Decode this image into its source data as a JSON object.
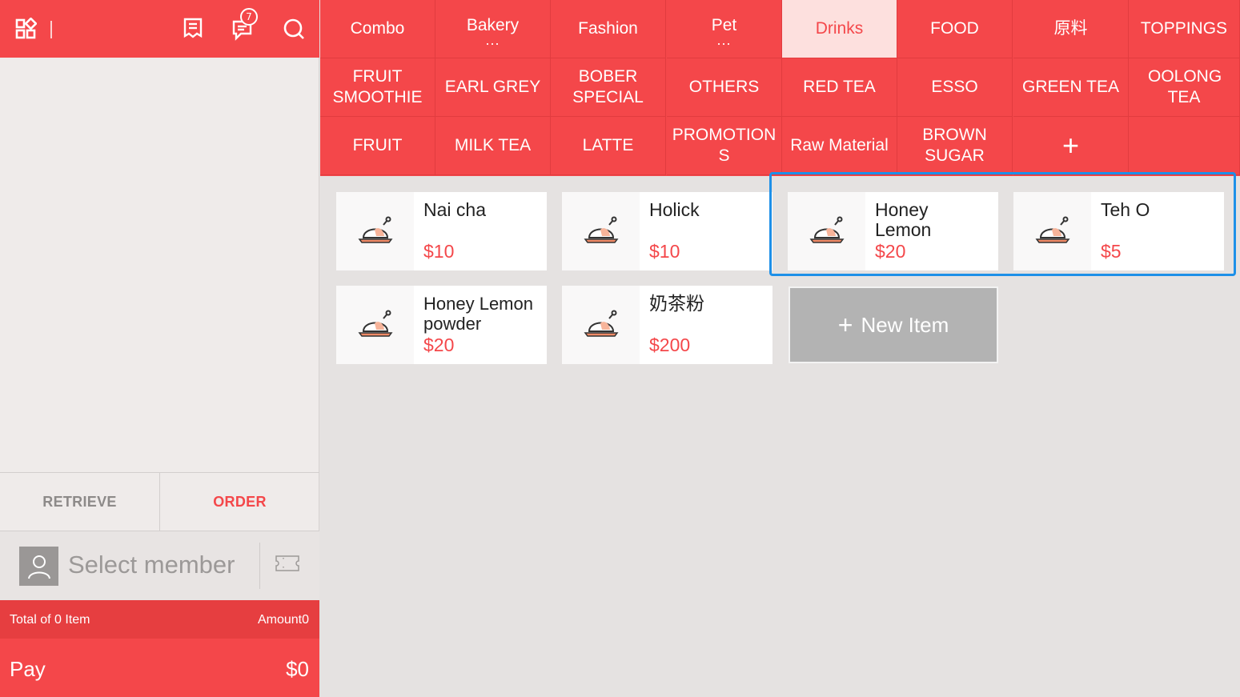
{
  "topbar": {
    "icons": [
      "apps-icon",
      "receipt-icon",
      "messages-icon",
      "search-icon"
    ],
    "badge_count": "7"
  },
  "categories": {
    "row1": [
      {
        "label": "Combo",
        "more": false
      },
      {
        "label": "Bakery",
        "more": true
      },
      {
        "label": "Fashion",
        "more": false
      },
      {
        "label": "Pet",
        "more": true
      },
      {
        "label": "Drinks",
        "more": false,
        "active": true
      },
      {
        "label": "FOOD",
        "more": false
      },
      {
        "label": "原料",
        "more": false
      },
      {
        "label": "TOPPINGS",
        "more": false
      }
    ],
    "row2": [
      "FRUIT SMOOTHIE",
      "EARL GREY",
      "BOBER SPECIAL",
      "OTHERS",
      "RED TEA",
      "ESSO",
      "GREEN TEA",
      "OOLONG TEA"
    ],
    "row3": [
      "FRUIT",
      "MILK TEA",
      "LATTE",
      "PROMOTION S",
      "Raw Material",
      "BROWN SUGAR"
    ],
    "add_label": "+",
    "more_dots": "..."
  },
  "products": [
    {
      "name": "Nai cha",
      "price": "$10"
    },
    {
      "name": "Holick",
      "price": "$10"
    },
    {
      "name": "Honey Lemon",
      "price": "$20"
    },
    {
      "name": "Teh O",
      "price": "$5"
    },
    {
      "name": "Honey Lemon powder",
      "price": "$20"
    },
    {
      "name": "奶茶粉",
      "price": "$200"
    }
  ],
  "new_item": {
    "plus": "+",
    "label": "New Item"
  },
  "actions": {
    "retrieve": "RETRIEVE",
    "order": "ORDER"
  },
  "member": {
    "label": "Select member"
  },
  "totals": {
    "items": "Total of 0 Item",
    "amount": "Amount0"
  },
  "pay": {
    "label": "Pay",
    "amount": "$0"
  },
  "colors": {
    "primary": "#f4474a",
    "active_bg": "#fde0de",
    "highlight": "#1e90e8",
    "new_item_bg": "#b3b3b3"
  }
}
